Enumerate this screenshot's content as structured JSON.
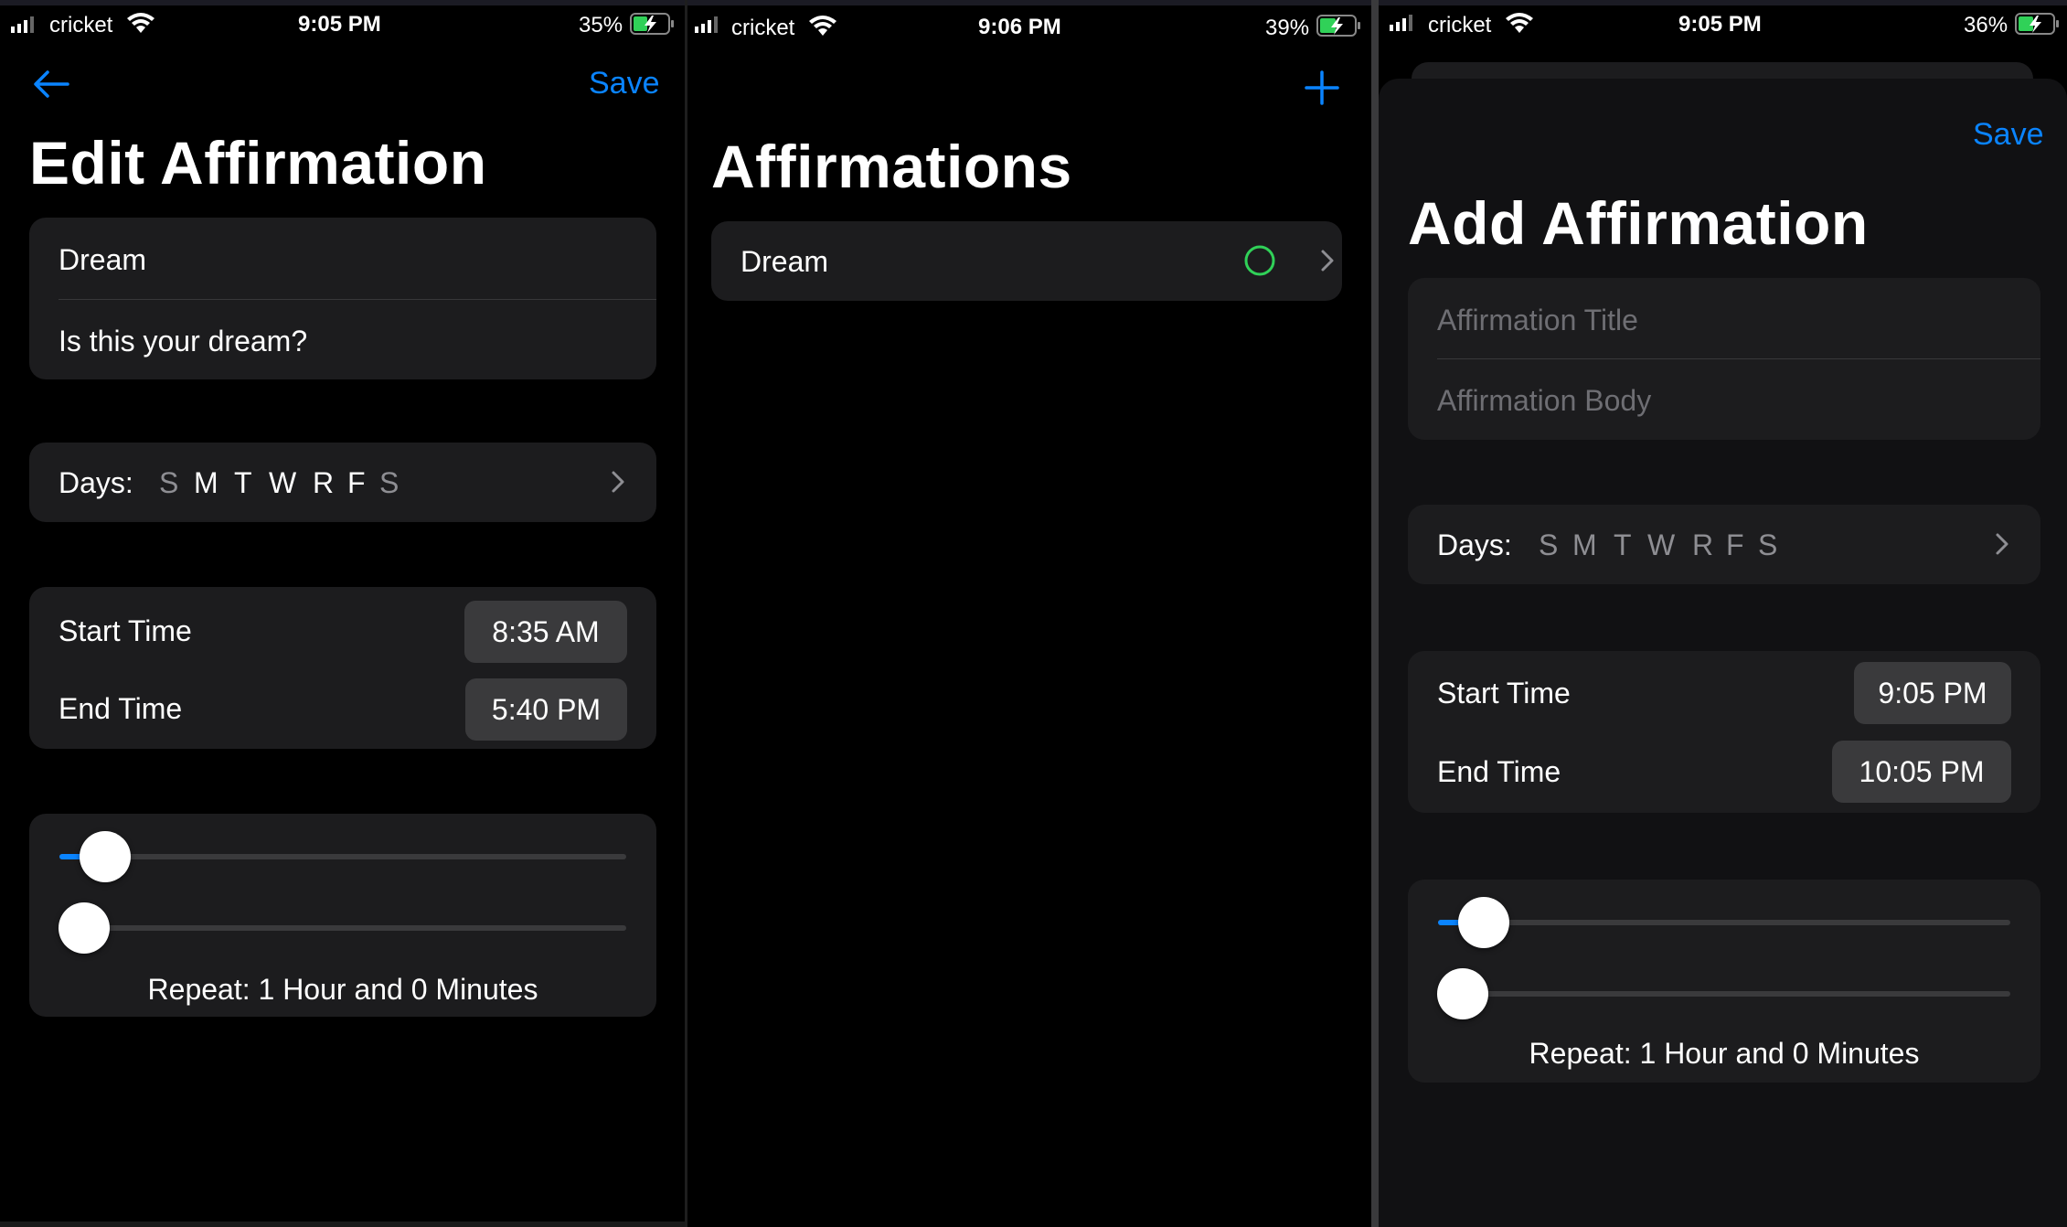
{
  "colors": {
    "accent": "#0a84ff",
    "background": "#000000",
    "card": "#1c1c1e",
    "ring": "#30d158"
  },
  "panels": [
    {
      "status": {
        "carrier": "cricket",
        "time": "9:05 PM",
        "battery": "35%"
      },
      "nav": {
        "back_icon": "arrow-left-icon",
        "save_label": "Save"
      },
      "title": "Edit Affirmation",
      "affirmation_title": "Dream",
      "affirmation_body": "Is this your dream?",
      "days_label": "Days:",
      "days": [
        "S",
        "M",
        "T",
        "W",
        "R",
        "F",
        "S"
      ],
      "start_label": "Start Time",
      "start_value": "8:35 AM",
      "end_label": "End Time",
      "end_value": "5:40 PM",
      "repeat_text": "Repeat: 1 Hour and 0 Minutes",
      "slider_hours": 0.06,
      "slider_minutes": 0.0
    },
    {
      "status": {
        "carrier": "cricket",
        "time": "9:06 PM",
        "battery": "39%"
      },
      "nav": {
        "add_icon": "plus-icon"
      },
      "title": "Affirmations",
      "items": [
        {
          "label": "Dream",
          "status_icon": "circle-icon"
        }
      ]
    },
    {
      "status": {
        "carrier": "cricket",
        "time": "9:05 PM",
        "battery": "36%"
      },
      "nav": {
        "save_label": "Save"
      },
      "title": "Add Affirmation",
      "title_placeholder": "Affirmation Title",
      "body_placeholder": "Affirmation Body",
      "days_label": "Days:",
      "days": [
        "S",
        "M",
        "T",
        "W",
        "R",
        "F",
        "S"
      ],
      "start_label": "Start Time",
      "start_value": "9:05 PM",
      "end_label": "End Time",
      "end_value": "10:05 PM",
      "repeat_text": "Repeat: 1 Hour and 0 Minutes",
      "slider_hours": 0.06,
      "slider_minutes": 0.0
    }
  ]
}
